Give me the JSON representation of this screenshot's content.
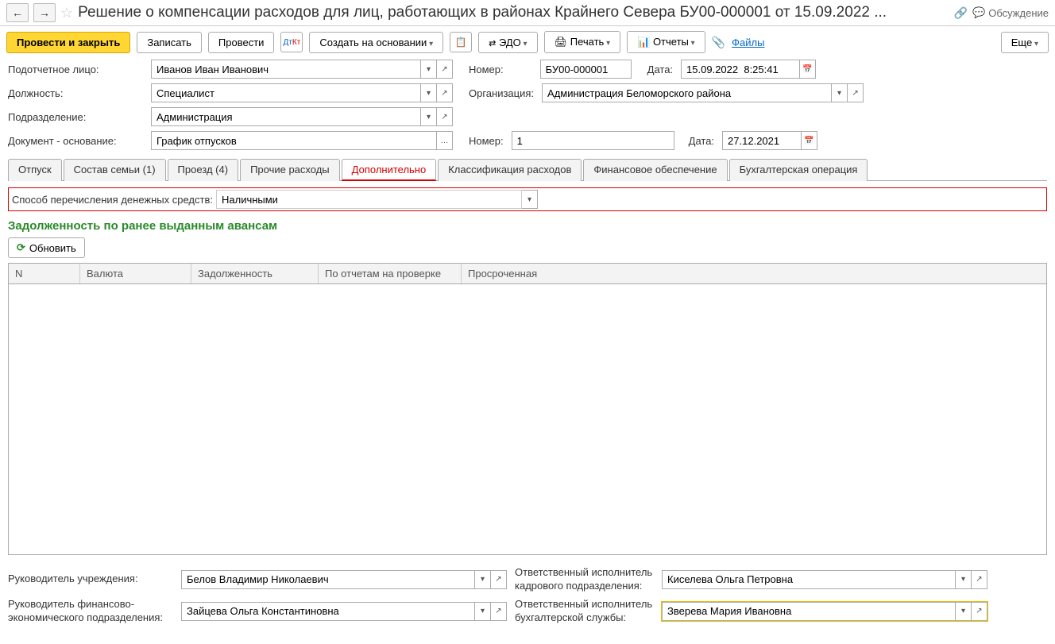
{
  "header": {
    "title": "Решение о компенсации расходов для лиц, работающих в районах Крайнего Севера БУ00-000001 от 15.09.2022 ...",
    "discussion": "Обсуждение"
  },
  "toolbar": {
    "post_close": "Провести и закрыть",
    "save": "Записать",
    "post": "Провести",
    "create_based": "Создать на основании",
    "edo": "ЭДО",
    "print": "Печать",
    "reports": "Отчеты",
    "files": "Файлы",
    "more": "Еще"
  },
  "form": {
    "person_label": "Подотчетное лицо:",
    "person_value": "Иванов Иван Иванович",
    "number_label": "Номер:",
    "number_value": "БУ00-000001",
    "date_label": "Дата:",
    "date_value": "15.09.2022  8:25:41",
    "position_label": "Должность:",
    "position_value": "Специалист",
    "org_label": "Организация:",
    "org_value": "Администрация Беломорского района",
    "dept_label": "Подразделение:",
    "dept_value": "Администрация",
    "basis_label": "Документ - основание:",
    "basis_value": "График отпусков",
    "basis_number_label": "Номер:",
    "basis_number_value": "1",
    "basis_date_label": "Дата:",
    "basis_date_value": "27.12.2021"
  },
  "tabs": {
    "vacation": "Отпуск",
    "family": "Состав семьи (1)",
    "travel": "Проезд (4)",
    "other": "Прочие расходы",
    "additional": "Дополнительно",
    "classification": "Классификация расходов",
    "financing": "Финансовое обеспечение",
    "accounting": "Бухгалтерская операция"
  },
  "additional": {
    "transfer_label": "Способ перечисления денежных средств:",
    "transfer_value": "Наличными",
    "debt_header": "Задолженность по ранее выданным авансам",
    "refresh": "Обновить"
  },
  "table_headers": {
    "n": "N",
    "currency": "Валюта",
    "debt": "Задолженность",
    "on_check": "По отчетам на проверке",
    "overdue": "Просроченная"
  },
  "footer": {
    "head_label": "Руководитель учреждения:",
    "head_value": "Белов Владимир Николаевич",
    "hr_label": "Ответственный исполнитель кадрового подразделения:",
    "hr_value": "Киселева Ольга Петровна",
    "fin_head_label": "Руководитель финансово-экономического подразделения:",
    "fin_head_value": "Зайцева Ольга Константиновна",
    "acc_label": "Ответственный исполнитель бухгалтерской службы:",
    "acc_value": "Зверева Мария Ивановна"
  }
}
